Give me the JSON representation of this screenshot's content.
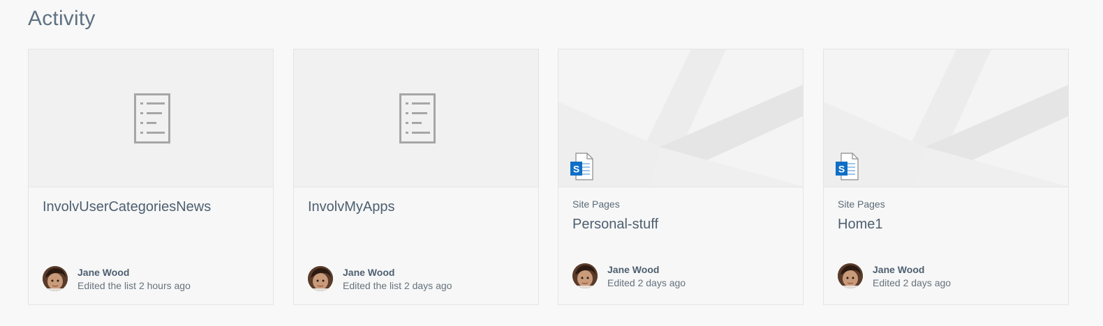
{
  "section": {
    "title": "Activity"
  },
  "cards": [
    {
      "kind": "list",
      "category": "",
      "title": "InvolvUserCategoriesNews",
      "author": "Jane Wood",
      "meta": "Edited the list 2 hours ago",
      "thumb_icon": "list-document-icon"
    },
    {
      "kind": "list",
      "category": "",
      "title": "InvolvMyApps",
      "author": "Jane Wood",
      "meta": "Edited the list 2 days ago",
      "thumb_icon": "list-document-icon"
    },
    {
      "kind": "page",
      "category": "Site Pages",
      "title": "Personal-stuff",
      "author": "Jane Wood",
      "meta": "Edited 2 days ago",
      "thumb_icon": "sharepoint-page-icon"
    },
    {
      "kind": "page",
      "category": "Site Pages",
      "title": "Home1",
      "author": "Jane Wood",
      "meta": "Edited 2 days ago",
      "thumb_icon": "sharepoint-page-icon"
    }
  ],
  "colors": {
    "background": "#f8f8f8",
    "title_text": "#5f7283",
    "sharepoint_blue": "#0f6fc6"
  }
}
